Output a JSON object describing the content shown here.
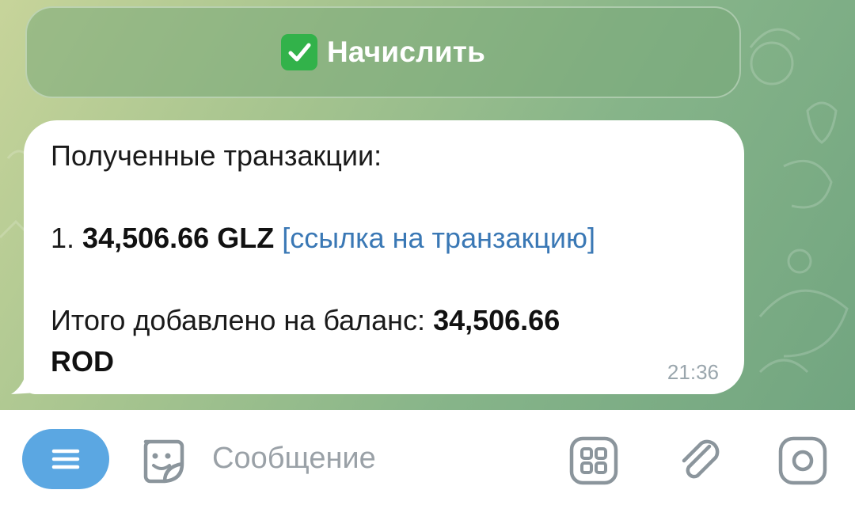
{
  "inline_keyboard": {
    "button_label": "Начислить",
    "button_icon": "check-mark-button-emoji"
  },
  "message": {
    "heading": "Полученные транзакции:",
    "item_number": "1.",
    "item_amount": "34,506.66 GLZ",
    "item_link": "[ссылка на транзакцию]",
    "total_label": "Итого добавлено на баланс:",
    "total_amount_line1": "34,506.66",
    "total_amount_line2": "ROD",
    "time": "21:36"
  },
  "composer": {
    "placeholder": "Сообщение",
    "menu_icon": "menu-icon",
    "sticker_icon": "sticker-icon",
    "keyboard_icon": "bot-keyboard-icon",
    "attach_icon": "paperclip-icon",
    "camera_icon": "camera-icon"
  },
  "colors": {
    "menu_button": "#5ba7e2",
    "link": "#3a78b5",
    "check_emoji": "#32b24a"
  }
}
